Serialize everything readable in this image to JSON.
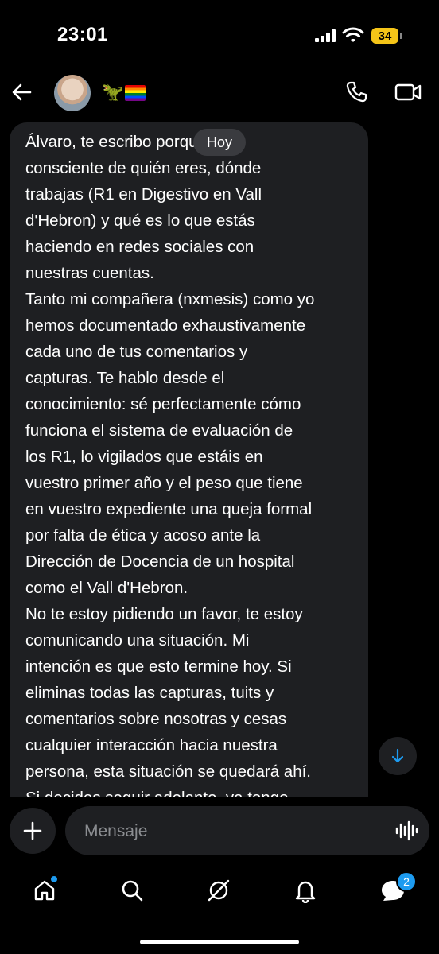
{
  "status_bar": {
    "time": "23:01",
    "battery": "34"
  },
  "header": {
    "emoji": "🦖",
    "flag": "rainbow-flag"
  },
  "day_separator": "Hoy",
  "message": {
    "text": "Álvaro, te escribo porque soy\nconsciente de quién eres, dónde\ntrabajas (R1 en Digestivo en Vall\nd'Hebron) y qué es lo que estás\nhaciendo en redes sociales con\nnuestras cuentas.\nTanto mi compañera (nxmesis) como yo\nhemos documentado exhaustivamente\ncada uno de tus comentarios y\ncapturas. Te hablo desde el\nconocimiento: sé perfectamente cómo\nfunciona el sistema de evaluación de\nlos R1, lo vigilados que estáis en\nvuestro primer año y el peso que tiene\nen vuestro expediente una queja formal\npor falta de ética y acoso ante la\nDirección de Docencia de un hospital\ncomo el Vall d'Hebron.\nNo te estoy pidiendo un favor, te estoy\ncomunicando una situación. Mi\nintención es que esto termine hoy. Si\neliminas todas las capturas, tuits y\ncomentarios sobre nosotras y cesas\ncualquier interacción hacia nuestra\npersona, esta situación se quedará ahí.\nSi decides seguir adelante, ya tengo"
  },
  "composer": {
    "placeholder": "Mensaje"
  },
  "nav": {
    "messages_badge": "2"
  },
  "colors": {
    "accent": "#1d9bf0",
    "bubble": "#1e1f22",
    "battery": "#f5c518"
  }
}
